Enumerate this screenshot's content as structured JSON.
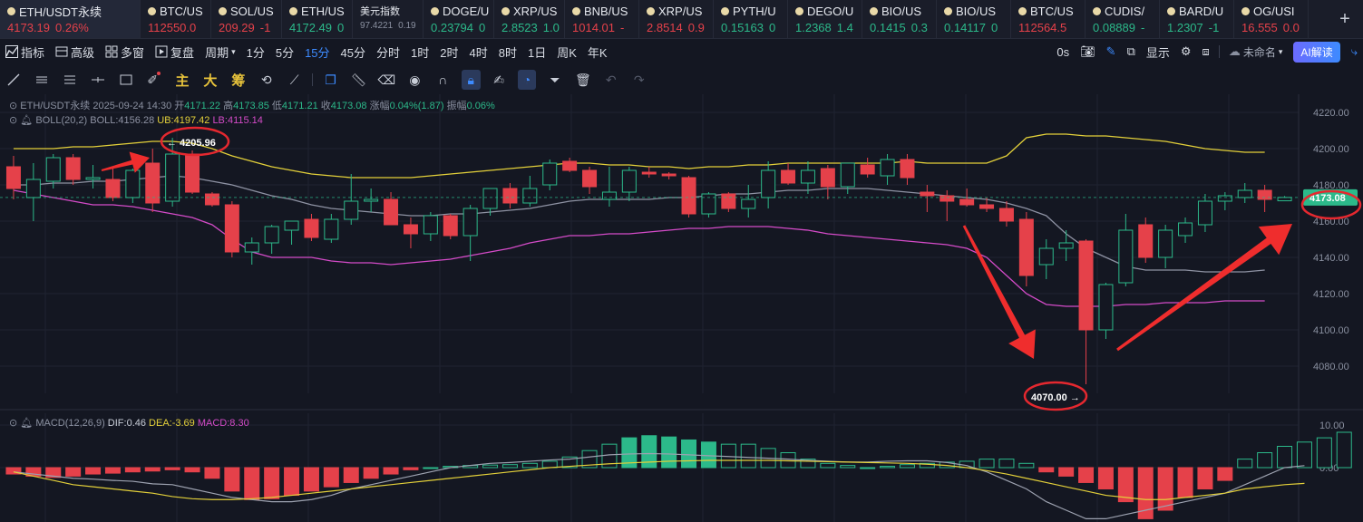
{
  "tickers": [
    {
      "sym": "ETH/USDT永续",
      "price": "4173.19",
      "change": "0.26%",
      "pc": "down",
      "cc": "down",
      "w": 155,
      "active": true,
      "coin": true
    },
    {
      "sym": "BTC/US",
      "price": "112550.0",
      "change": "",
      "pc": "down",
      "cc": "down",
      "w": 78,
      "coin": true
    },
    {
      "sym": "SOL/US",
      "price": "209.29",
      "change": "-1",
      "pc": "down",
      "cc": "down",
      "w": 78,
      "coin": true
    },
    {
      "sym": "ETH/US",
      "price": "4172.49",
      "change": "0",
      "pc": "up",
      "cc": "up",
      "w": 78,
      "coin": true
    },
    {
      "sym": "美元指数",
      "price": "97.4221",
      "change": "0.19",
      "pc": "muted",
      "cc": "muted",
      "w": 78,
      "coin": false,
      "small": true
    },
    {
      "sym": "DOGE/U",
      "price": "0.23794",
      "change": "0",
      "pc": "up",
      "cc": "up",
      "w": 78,
      "coin": true
    },
    {
      "sym": "XRP/US",
      "price": "2.8523",
      "change": "1.0",
      "pc": "up",
      "cc": "up",
      "w": 78,
      "coin": true
    },
    {
      "sym": "BNB/US",
      "price": "1014.01",
      "change": "-",
      "pc": "down",
      "cc": "down",
      "w": 82,
      "coin": true
    },
    {
      "sym": "XRP/US",
      "price": "2.8514",
      "change": "0.9",
      "pc": "down",
      "cc": "down",
      "w": 82,
      "coin": true
    },
    {
      "sym": "PYTH/U",
      "price": "0.15163",
      "change": "0",
      "pc": "up",
      "cc": "up",
      "w": 82,
      "coin": true
    },
    {
      "sym": "DEGO/U",
      "price": "1.2368",
      "change": "1.4",
      "pc": "up",
      "cc": "up",
      "w": 82,
      "coin": true
    },
    {
      "sym": "BIO/US",
      "price": "0.1415",
      "change": "0.3",
      "pc": "up",
      "cc": "up",
      "w": 82,
      "coin": true
    },
    {
      "sym": "BIO/US",
      "price": "0.14117",
      "change": "0",
      "pc": "up",
      "cc": "up",
      "w": 82,
      "coin": true
    },
    {
      "sym": "BTC/US",
      "price": "112564.5",
      "change": "",
      "pc": "down",
      "cc": "down",
      "w": 82,
      "coin": true
    },
    {
      "sym": "CUDIS/",
      "price": "0.08889",
      "change": "-",
      "pc": "up",
      "cc": "up",
      "w": 82,
      "coin": true
    },
    {
      "sym": "BARD/U",
      "price": "1.2307",
      "change": "-1",
      "pc": "up",
      "cc": "up",
      "w": 82,
      "coin": true
    },
    {
      "sym": "OG/USI",
      "price": "16.555",
      "change": "0.0",
      "pc": "down",
      "cc": "down",
      "w": 82,
      "coin": true
    }
  ],
  "plus_label": "+",
  "toolbar": {
    "items": [
      "指标",
      "高级",
      "多窗",
      "复盘",
      "周期"
    ],
    "icons": [
      "indicator-icon",
      "advanced-icon",
      "multi-window-icon",
      "replay-icon"
    ],
    "periods": [
      "1分",
      "5分",
      "15分",
      "45分",
      "分时",
      "1时",
      "2时",
      "4时",
      "8时",
      "1日",
      "周K",
      "年K"
    ],
    "active_period": "15分",
    "seconds": "0s",
    "display": "显示",
    "unnamed": "未命名",
    "ai": "AI解读"
  },
  "drawing_tools": {
    "zhu": "主",
    "da": "大",
    "chou": "筹"
  },
  "legend": {
    "title": "ETH/USDT永续  2025-09-24 14:30",
    "open_label": "开",
    "open": "4171.22",
    "high_label": "高",
    "high": "4173.85",
    "low_label": "低",
    "low": "4171.21",
    "close_label": "收",
    "close": "4173.08",
    "chg_label": "涨幅",
    "chg": "0.04%(1.87)",
    "amp_label": "振幅",
    "amp": "0.06%",
    "boll_name": "BOLL(20,2)",
    "boll": "BOLL:4156.28",
    "ub": "UB:4197.42",
    "lb": "LB:4115.14",
    "macd_name": "MACD(12,26,9)",
    "dif": "DIF:0.46",
    "dea": "DEA:-3.69",
    "macd": "MACD:8.30"
  },
  "annotations": {
    "high": "4205.96",
    "low": "4070.00",
    "current": "4173.08"
  },
  "colors": {
    "up": "#2cb98a",
    "down": "#e5414a",
    "boll_mid": "#8e92a3",
    "boll_ub": "#e3d03a",
    "boll_lb": "#d44bc8",
    "accent": "#3d8bff",
    "annotation": "#e5282f"
  },
  "chart_data": {
    "type": "candlestick",
    "price_ylim": [
      4070,
      4230
    ],
    "price_ticks": [
      4220,
      4200,
      4180,
      4160,
      4140,
      4120,
      4100,
      4080
    ],
    "price_tick_labels": [
      "4220.00",
      "4200.00",
      "4180.00",
      "4160.00",
      "4140.00",
      "4120.00",
      "4100.00",
      "4080.00"
    ],
    "macd_ylim": [
      -12,
      12
    ],
    "macd_ticks": [
      10,
      0
    ],
    "macd_tick_labels": [
      "10.00",
      "0.00"
    ],
    "candles": [
      {
        "o": 4190,
        "h": 4196,
        "l": 4172,
        "c": 4178
      },
      {
        "o": 4173,
        "h": 4192,
        "l": 4160,
        "c": 4183
      },
      {
        "o": 4182,
        "h": 4197,
        "l": 4178,
        "c": 4195
      },
      {
        "o": 4195,
        "h": 4197,
        "l": 4180,
        "c": 4183
      },
      {
        "o": 4183,
        "h": 4191,
        "l": 4178,
        "c": 4184
      },
      {
        "o": 4183,
        "h": 4189,
        "l": 4171,
        "c": 4173
      },
      {
        "o": 4173,
        "h": 4189,
        "l": 4170,
        "c": 4188
      },
      {
        "o": 4192,
        "h": 4200,
        "l": 4165,
        "c": 4170
      },
      {
        "o": 4171,
        "h": 4205.96,
        "l": 4168,
        "c": 4197
      },
      {
        "o": 4197,
        "h": 4199,
        "l": 4175,
        "c": 4176
      },
      {
        "o": 4175,
        "h": 4176,
        "l": 4168,
        "c": 4169
      },
      {
        "o": 4169,
        "h": 4171,
        "l": 4140,
        "c": 4143
      },
      {
        "o": 4143,
        "h": 4151,
        "l": 4136,
        "c": 4148
      },
      {
        "o": 4148,
        "h": 4158,
        "l": 4142,
        "c": 4157
      },
      {
        "o": 4155,
        "h": 4160,
        "l": 4147,
        "c": 4160
      },
      {
        "o": 4161,
        "h": 4164,
        "l": 4149,
        "c": 4151
      },
      {
        "o": 4150,
        "h": 4164,
        "l": 4148,
        "c": 4161
      },
      {
        "o": 4161,
        "h": 4186,
        "l": 4158,
        "c": 4171
      },
      {
        "o": 4171,
        "h": 4178,
        "l": 4165,
        "c": 4172
      },
      {
        "o": 4172,
        "h": 4176,
        "l": 4158,
        "c": 4158
      },
      {
        "o": 4158,
        "h": 4162,
        "l": 4145,
        "c": 4153
      },
      {
        "o": 4153,
        "h": 4165,
        "l": 4149,
        "c": 4163
      },
      {
        "o": 4163,
        "h": 4164,
        "l": 4150,
        "c": 4152
      },
      {
        "o": 4152,
        "h": 4169,
        "l": 4138,
        "c": 4167
      },
      {
        "o": 4167,
        "h": 4178,
        "l": 4163,
        "c": 4178
      },
      {
        "o": 4178,
        "h": 4181,
        "l": 4167,
        "c": 4170
      },
      {
        "o": 4170,
        "h": 4185,
        "l": 4168,
        "c": 4178
      },
      {
        "o": 4180,
        "h": 4194,
        "l": 4177,
        "c": 4192
      },
      {
        "o": 4193,
        "h": 4195,
        "l": 4187,
        "c": 4188
      },
      {
        "o": 4188,
        "h": 4190,
        "l": 4175,
        "c": 4179
      },
      {
        "o": 4172,
        "h": 4190,
        "l": 4168,
        "c": 4176
      },
      {
        "o": 4176,
        "h": 4190,
        "l": 4171,
        "c": 4188
      },
      {
        "o": 4187,
        "h": 4190,
        "l": 4184,
        "c": 4186
      },
      {
        "o": 4186,
        "h": 4187,
        "l": 4183,
        "c": 4185
      },
      {
        "o": 4184,
        "h": 4185,
        "l": 4162,
        "c": 4164
      },
      {
        "o": 4164,
        "h": 4176,
        "l": 4162,
        "c": 4175
      },
      {
        "o": 4175,
        "h": 4176,
        "l": 4165,
        "c": 4167
      },
      {
        "o": 4167,
        "h": 4180,
        "l": 4162,
        "c": 4172
      },
      {
        "o": 4173,
        "h": 4193,
        "l": 4167,
        "c": 4188
      },
      {
        "o": 4188,
        "h": 4192,
        "l": 4180,
        "c": 4181
      },
      {
        "o": 4181,
        "h": 4193,
        "l": 4175,
        "c": 4188
      },
      {
        "o": 4189,
        "h": 4191,
        "l": 4172,
        "c": 4179
      },
      {
        "o": 4179,
        "h": 4192,
        "l": 4175,
        "c": 4192
      },
      {
        "o": 4191,
        "h": 4195,
        "l": 4184,
        "c": 4186
      },
      {
        "o": 4185,
        "h": 4197,
        "l": 4180,
        "c": 4194
      },
      {
        "o": 4194,
        "h": 4197,
        "l": 4180,
        "c": 4184
      },
      {
        "o": 4176,
        "h": 4180,
        "l": 4165,
        "c": 4174
      },
      {
        "o": 4174,
        "h": 4177,
        "l": 4160,
        "c": 4171
      },
      {
        "o": 4172,
        "h": 4178,
        "l": 4168,
        "c": 4169
      },
      {
        "o": 4169,
        "h": 4173,
        "l": 4165,
        "c": 4167
      },
      {
        "o": 4167,
        "h": 4171,
        "l": 4157,
        "c": 4160
      },
      {
        "o": 4161,
        "h": 4165,
        "l": 4124,
        "c": 4130
      },
      {
        "o": 4136,
        "h": 4150,
        "l": 4128,
        "c": 4145
      },
      {
        "o": 4145,
        "h": 4155,
        "l": 4138,
        "c": 4148
      },
      {
        "o": 4149,
        "h": 4150,
        "l": 4070,
        "c": 4100
      },
      {
        "o": 4100,
        "h": 4126,
        "l": 4095,
        "c": 4125
      },
      {
        "o": 4126,
        "h": 4164,
        "l": 4124,
        "c": 4155
      },
      {
        "o": 4158,
        "h": 4162,
        "l": 4137,
        "c": 4140
      },
      {
        "o": 4140,
        "h": 4158,
        "l": 4134,
        "c": 4155
      },
      {
        "o": 4152,
        "h": 4162,
        "l": 4148,
        "c": 4159
      },
      {
        "o": 4158,
        "h": 4175,
        "l": 4154,
        "c": 4171
      },
      {
        "o": 4171,
        "h": 4176,
        "l": 4166,
        "c": 4174
      },
      {
        "o": 4173,
        "h": 4181,
        "l": 4170,
        "c": 4177
      },
      {
        "o": 4177,
        "h": 4180,
        "l": 4165,
        "c": 4172
      },
      {
        "o": 4171.22,
        "h": 4173.85,
        "l": 4171.21,
        "c": 4173.08
      }
    ],
    "boll_ub": [
      4200,
      4200,
      4200,
      4201,
      4201,
      4202,
      4203,
      4204,
      4204,
      4203,
      4200,
      4196,
      4193,
      4190,
      4188,
      4186,
      4185,
      4184,
      4184,
      4184,
      4184,
      4185,
      4186,
      4187,
      4188,
      4189,
      4190,
      4191,
      4192,
      4192,
      4191,
      4191,
      4190,
      4190,
      4189,
      4190,
      4190,
      4191,
      4191,
      4192,
      4192,
      4192,
      4192,
      4192,
      4192,
      4193,
      4192,
      4192,
      4192,
      4192,
      4196,
      4206,
      4208,
      4208,
      4207,
      4207,
      4206,
      4205,
      4204,
      4202,
      4200,
      4199,
      4198,
      4198
    ],
    "boll_mid": [
      4180,
      4180,
      4181,
      4181,
      4182,
      4182,
      4183,
      4184,
      4185,
      4184,
      4182,
      4180,
      4177,
      4174,
      4172,
      4169,
      4167,
      4166,
      4165,
      4164,
      4163,
      4163,
      4164,
      4164,
      4165,
      4166,
      4167,
      4169,
      4171,
      4172,
      4172,
      4172,
      4172,
      4173,
      4173,
      4174,
      4175,
      4175,
      4176,
      4177,
      4177,
      4178,
      4178,
      4178,
      4177,
      4176,
      4175,
      4174,
      4173,
      4172,
      4170,
      4167,
      4163,
      4153,
      4145,
      4140,
      4135,
      4133,
      4133,
      4133,
      4132,
      4132,
      4132,
      4133
    ],
    "boll_lb": [
      4177,
      4175,
      4173,
      4171,
      4169,
      4169,
      4168,
      4166,
      4164,
      4162,
      4158,
      4150,
      4143,
      4140,
      4140,
      4140,
      4138,
      4137,
      4137,
      4136,
      4137,
      4138,
      4139,
      4141,
      4143,
      4145,
      4148,
      4150,
      4152,
      4152,
      4153,
      4153,
      4154,
      4155,
      4156,
      4156,
      4157,
      4157,
      4157,
      4156,
      4155,
      4153,
      4152,
      4151,
      4150,
      4149,
      4148,
      4147,
      4145,
      4140,
      4130,
      4120,
      4114,
      4113,
      4113,
      4113,
      4114,
      4114,
      4115,
      4115,
      4115,
      4116,
      4116,
      4116
    ],
    "macd_hist": [
      -1.5,
      -2.0,
      -2.3,
      -2.0,
      -1.5,
      -1.3,
      -1.0,
      -0.8,
      -0.5,
      -1.0,
      -2.5,
      -5.5,
      -7.5,
      -7.3,
      -6.5,
      -5.5,
      -4.5,
      -3.5,
      -2.5,
      -1.5,
      -0.5,
      0.0,
      0.3,
      0.5,
      0.6,
      0.7,
      1.0,
      1.5,
      2.5,
      4.0,
      5.5,
      7.0,
      7.5,
      7.2,
      6.5,
      6.0,
      5.5,
      5.5,
      4.5,
      3.5,
      2.0,
      1.0,
      0.5,
      0.0,
      0.3,
      0.7,
      1.0,
      1.3,
      1.5,
      2.0,
      2.0,
      1.0,
      -1.0,
      -2.0,
      -3.5,
      -5.0,
      -8.0,
      -12.0,
      -10.0,
      -7.0,
      -5.0,
      -3.0,
      2.0,
      3.5,
      5.0,
      6.0,
      7.0,
      8.3
    ],
    "macd_dif": [
      -1,
      -1.5,
      -2,
      -2.5,
      -2.7,
      -3,
      -3.2,
      -3.8,
      -4,
      -5,
      -6,
      -7,
      -7.5,
      -8,
      -8,
      -7.5,
      -6.5,
      -5,
      -4,
      -3,
      -2,
      -1,
      0,
      0.5,
      1,
      1.2,
      1.5,
      1.8,
      2,
      2.5,
      3,
      3.2,
      3.3,
      3.2,
      3,
      2.8,
      2.6,
      2.4,
      2.2,
      2,
      1.7,
      1.5,
      1.3,
      1.3,
      1.5,
      1.6,
      1.6,
      1.2,
      0.5,
      -1,
      -3,
      -5,
      -8,
      -10,
      -12,
      -12,
      -11,
      -10,
      -9,
      -8,
      -7,
      -6,
      -4,
      -2,
      0,
      0.46
    ],
    "macd_dea": [
      -1,
      -2,
      -3,
      -4,
      -4.5,
      -5,
      -5.5,
      -6,
      -6.8,
      -7.3,
      -7.5,
      -7.5,
      -7.3,
      -7,
      -6.5,
      -6,
      -5.5,
      -5,
      -4.5,
      -4,
      -3.5,
      -3,
      -2.5,
      -2,
      -1.5,
      -1,
      -0.5,
      0,
      0.3,
      0.6,
      0.9,
      1.1,
      1.3,
      1.5,
      1.6,
      1.7,
      1.7,
      1.7,
      1.7,
      1.6,
      1.5,
      1.4,
      1.3,
      1.2,
      1.1,
      1.0,
      0.8,
      0.5,
      0,
      -0.7,
      -1.5,
      -2.5,
      -3.5,
      -4.5,
      -5.5,
      -6.5,
      -7,
      -7.5,
      -7.5,
      -7,
      -6.5,
      -6,
      -5,
      -4.5,
      -4,
      -3.69
    ]
  }
}
